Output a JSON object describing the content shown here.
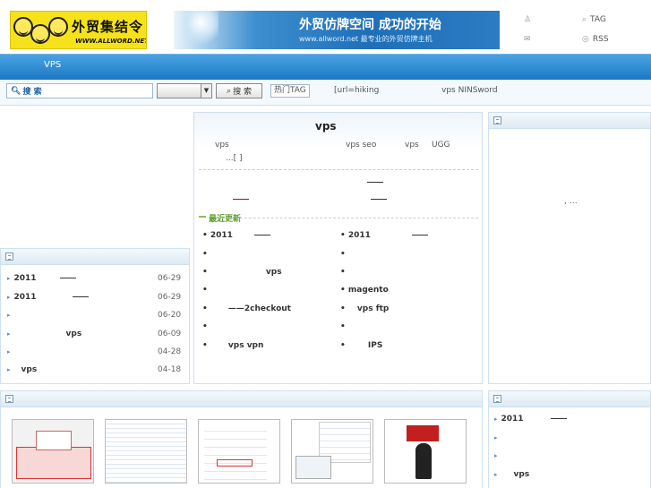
{
  "logo": {
    "title": "外贸集结令",
    "url": "WWW.ALLWORD.NET"
  },
  "banner": {
    "headline": "外贸仿牌空间  成功的开始",
    "subline": "www.allword.net 最专业的外贸仿牌主机"
  },
  "toplinks": [
    {
      "label": "",
      "sym": "♙"
    },
    {
      "label": "TAG",
      "sym": "⌕"
    },
    {
      "label": "",
      "sym": "✉"
    },
    {
      "label": "RSS",
      "sym": "◎"
    }
  ],
  "nav": {
    "item": "VPS"
  },
  "search": {
    "label": "搜 索",
    "button": "搜 索",
    "hot_tag": "热门TAG",
    "hot1": "[url=hiking",
    "hot2": "vps  NINSword"
  },
  "main": {
    "title": "vps",
    "summary_a": "vps",
    "summary_b": "vps  seo",
    "summary_c": "vps",
    "summary_d": "UGG",
    "more": "...[   ]",
    "recent_label": "最近更新",
    "left_list": [
      "2011",
      "",
      "vps",
      "",
      "——2checkout",
      "",
      "vps     vpn"
    ],
    "right_list": [
      "2011",
      "",
      "",
      "magento",
      "vps     ftp",
      "",
      "IPS"
    ]
  },
  "right_panel": {
    "text": ",  …"
  },
  "left_panel": {
    "items": [
      {
        "label": "2011",
        "date": "06-29"
      },
      {
        "label": "2011",
        "date": "06-29"
      },
      {
        "label": "",
        "date": "06-20"
      },
      {
        "label": "vps",
        "date": "06-09"
      },
      {
        "label": "",
        "date": "04-28"
      },
      {
        "label": "vps",
        "date": "04-18"
      }
    ]
  },
  "bottom_right": {
    "items": [
      "2011",
      "",
      "",
      "vps"
    ]
  }
}
